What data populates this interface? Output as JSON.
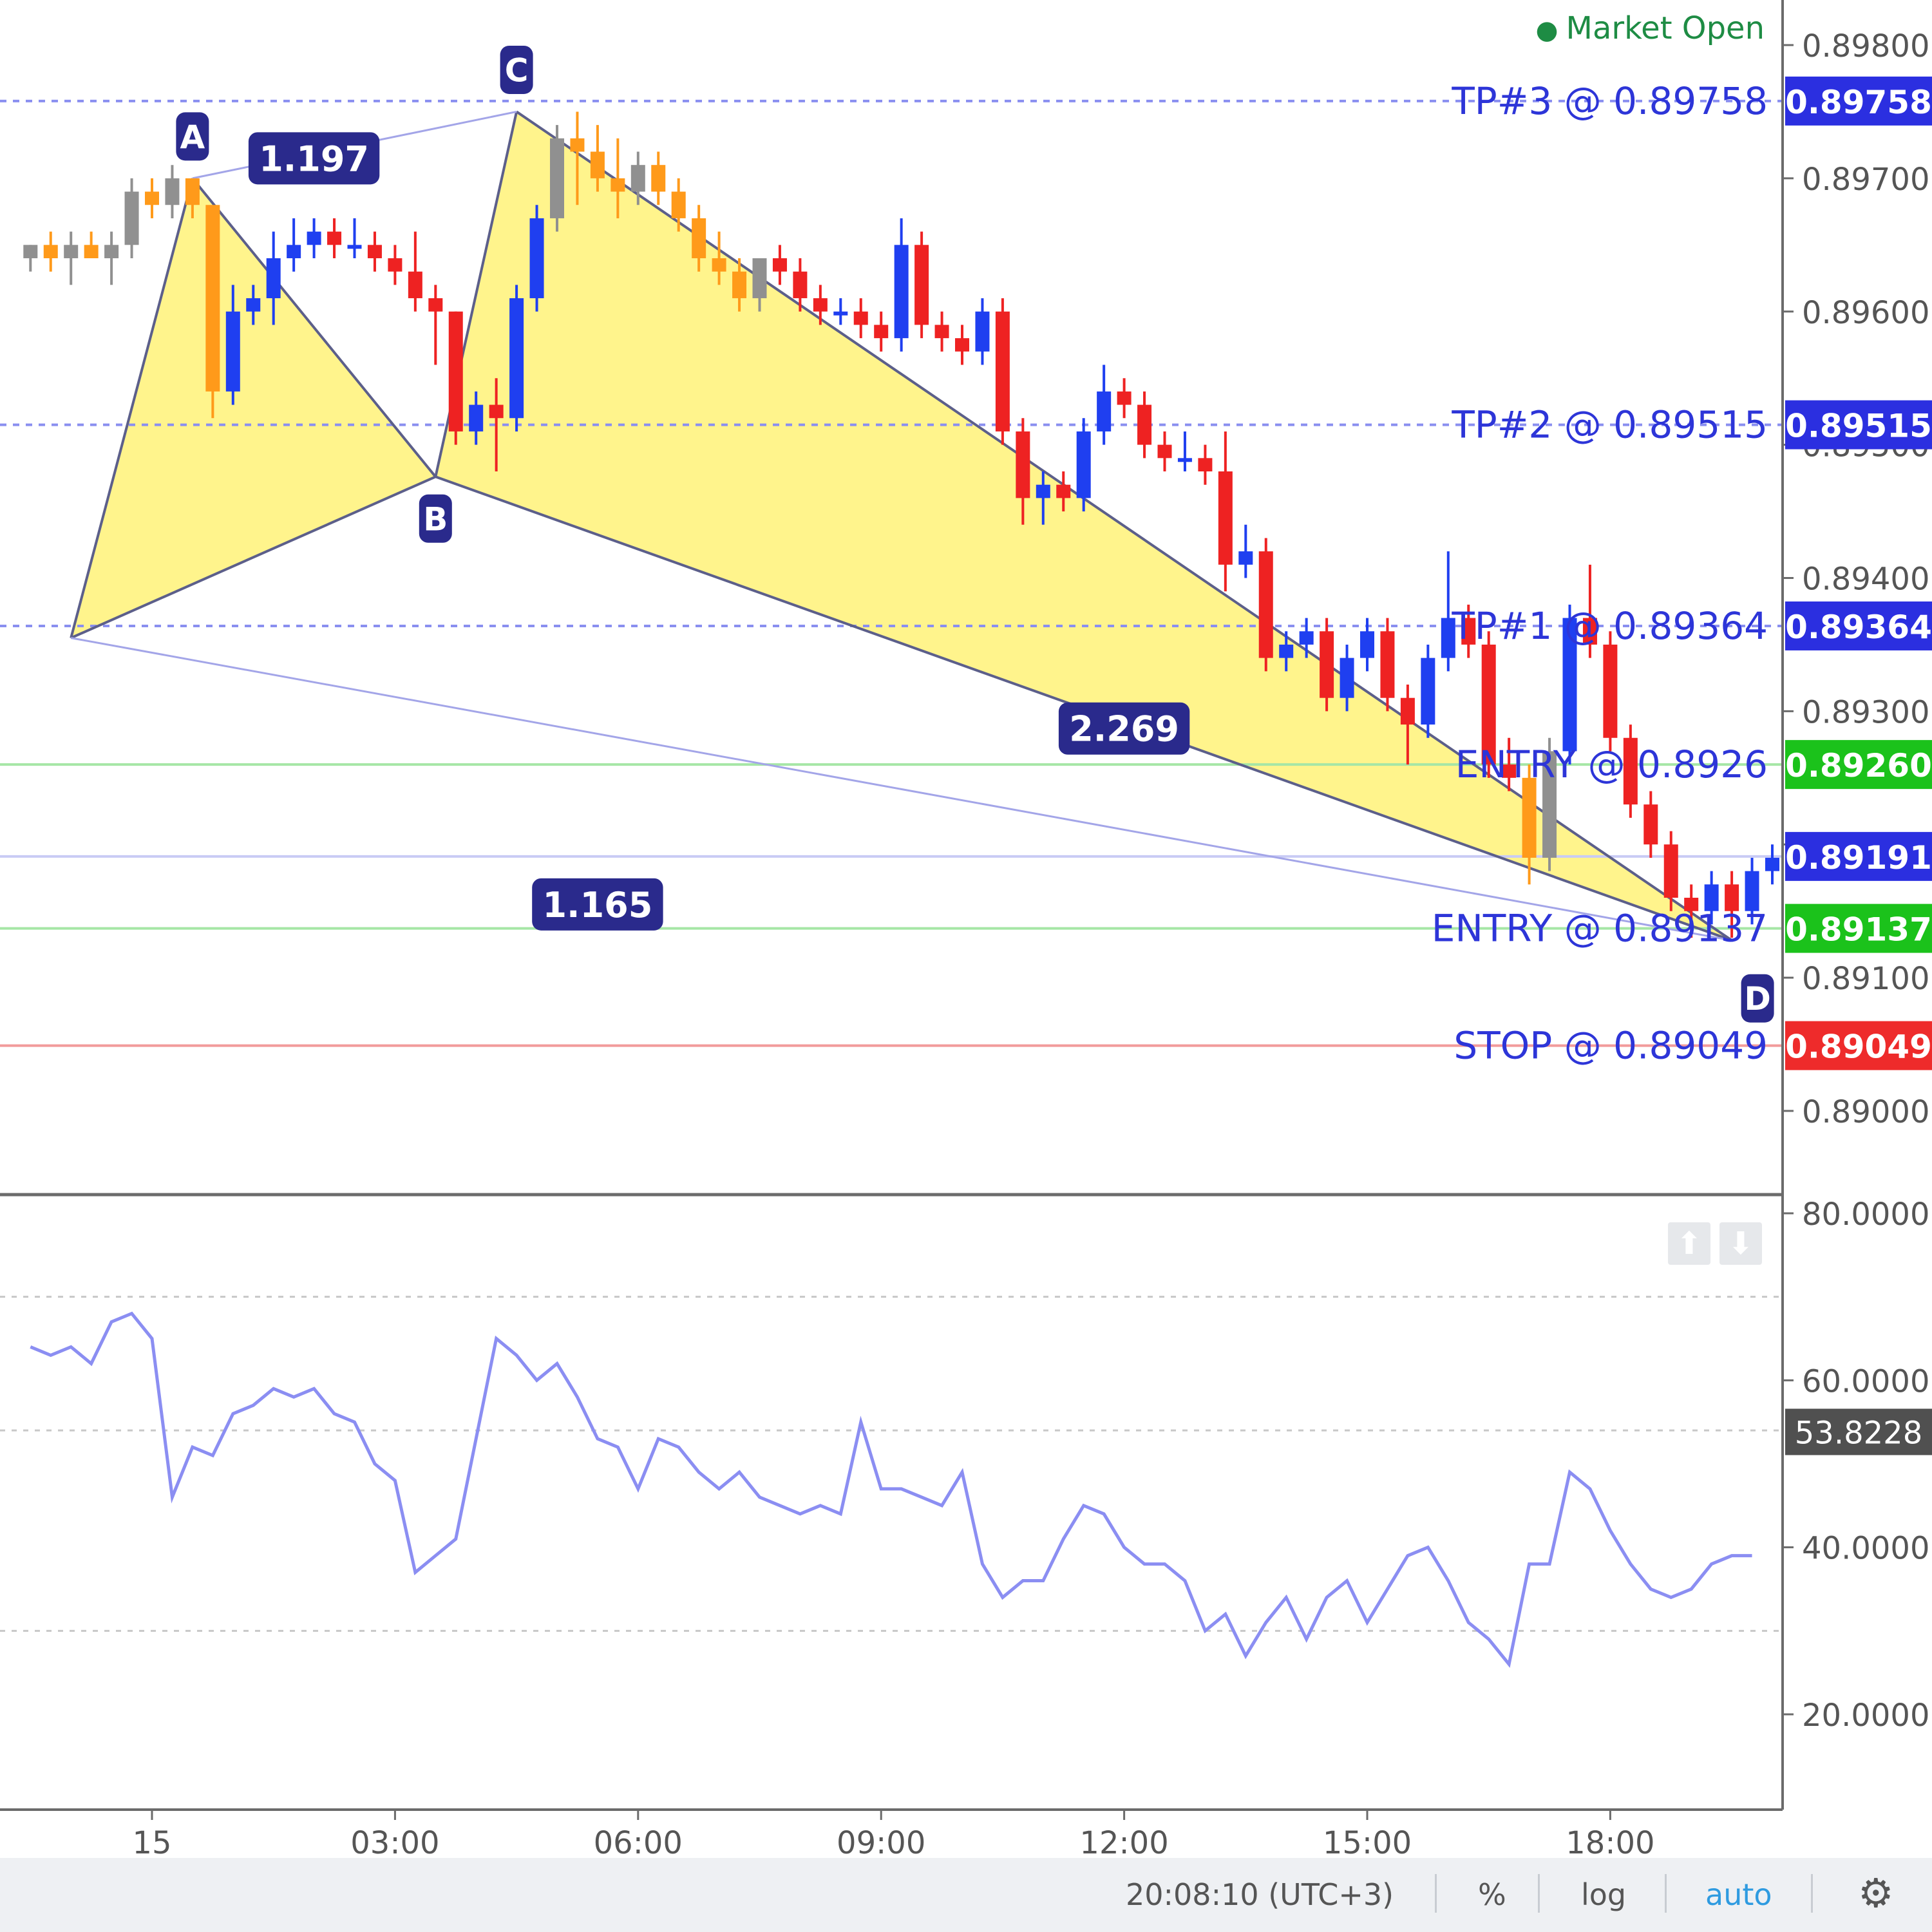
{
  "header": {
    "market_status": "Market Open"
  },
  "price_axis": {
    "ticks": [
      "0.89800",
      "0.89700",
      "0.89600",
      "0.89500",
      "0.89400",
      "0.89300",
      "0.89200",
      "0.89100",
      "0.89000"
    ],
    "tick_values": [
      0.898,
      0.897,
      0.896,
      0.895,
      0.894,
      0.893,
      0.892,
      0.891,
      0.89
    ]
  },
  "levels": [
    {
      "name": "tp3",
      "value": 0.89758,
      "label": "TP#3 @ 0.89758",
      "tag": "0.89758",
      "style": "dashed",
      "line_color": "#8a8ff0",
      "tag_color": "#2b2fe0"
    },
    {
      "name": "tp2",
      "value": 0.89515,
      "label": "TP#2 @ 0.89515",
      "tag": "0.89515",
      "style": "dashed",
      "line_color": "#8a8ff0",
      "tag_color": "#2b2fe0"
    },
    {
      "name": "tp1",
      "value": 0.89364,
      "label": "TP#1 @ 0.89364",
      "tag": "0.89364",
      "style": "dashed",
      "line_color": "#8a8ff0",
      "tag_color": "#2b2fe0"
    },
    {
      "name": "entry1",
      "value": 0.8926,
      "label": "ENTRY @ 0.8926",
      "tag": "0.89260",
      "style": "solid",
      "line_color": "#a6e6a6",
      "tag_color": "#1bc21b"
    },
    {
      "name": "last",
      "value": 0.89191,
      "label": "",
      "tag": "0.89191",
      "style": "solid",
      "line_color": "#c9cbf5",
      "tag_color": "#2b2fe0"
    },
    {
      "name": "entry2",
      "value": 0.89137,
      "label": "ENTRY @ 0.89137",
      "tag": "0.89137",
      "style": "solid",
      "line_color": "#a6e6a6",
      "tag_color": "#1bc21b"
    },
    {
      "name": "stop",
      "value": 0.89049,
      "label": "STOP @ 0.89049",
      "tag": "0.89049",
      "style": "solid",
      "line_color": "#f29b9b",
      "tag_color": "#ee2b2b"
    }
  ],
  "pattern": {
    "points": [
      {
        "label": "A",
        "x": "00:30",
        "value": 0.897
      },
      {
        "label": "B",
        "x": "03:30",
        "value": 0.89476
      },
      {
        "label": "C",
        "x": "04:30",
        "value": 0.8975
      },
      {
        "label": "D",
        "x": "19:30",
        "value": 0.89128
      }
    ],
    "X": {
      "x": "-01:00",
      "value": 0.89355
    },
    "ratios": [
      {
        "label": "1.197",
        "x": "02:00",
        "value": 0.89715
      },
      {
        "label": "2.269",
        "x": "12:00",
        "value": 0.89287
      },
      {
        "label": "1.165",
        "x": "05:30",
        "value": 0.89155
      }
    ],
    "fill_color": "#fff48c"
  },
  "x_axis": {
    "ticks": [
      "15",
      "03:00",
      "06:00",
      "09:00",
      "12:00",
      "15:00",
      "18:00"
    ],
    "tick_hours": [
      0,
      3,
      6,
      9,
      12,
      15,
      18
    ]
  },
  "oscillator": {
    "ticks": [
      "80.0000",
      "60.0000",
      "40.0000",
      "20.0000"
    ],
    "tick_values": [
      80,
      60,
      40,
      20
    ],
    "bands": [
      70,
      54,
      30
    ],
    "current": "53.8228",
    "current_value": 53.82
  },
  "status_bar": {
    "clock": "20:08:10 (UTC+3)",
    "percent": "%",
    "log": "log",
    "auto": "auto"
  },
  "chart_data": {
    "type": "candlestick",
    "x_unit": "hours since 00:00",
    "colors": {
      "up": "#1f3ff0",
      "down": "#ee2222",
      "pattern_up": "#909090",
      "pattern_down": "#ff9a1a",
      "line": "#8b8ef2"
    },
    "candles": [
      [
        -1.5,
        0.8964,
        0.8965,
        0.8963,
        0.8965
      ],
      [
        -1.25,
        0.8965,
        0.8966,
        0.8963,
        0.8964
      ],
      [
        -1.0,
        0.8964,
        0.8966,
        0.8962,
        0.8965
      ],
      [
        -0.75,
        0.8965,
        0.8966,
        0.8964,
        0.8964
      ],
      [
        -0.5,
        0.8964,
        0.8966,
        0.8962,
        0.8965
      ],
      [
        -0.25,
        0.8965,
        0.897,
        0.8964,
        0.8969
      ],
      [
        0.0,
        0.8969,
        0.897,
        0.8967,
        0.8968
      ],
      [
        0.25,
        0.8968,
        0.8971,
        0.8967,
        0.897
      ],
      [
        0.5,
        0.897,
        0.8969,
        0.8967,
        0.8968
      ],
      [
        0.75,
        0.8968,
        0.8963,
        0.8952,
        0.8954
      ],
      [
        1.0,
        0.8954,
        0.8962,
        0.8953,
        0.896
      ],
      [
        1.25,
        0.896,
        0.8962,
        0.8959,
        0.8961
      ],
      [
        1.5,
        0.8961,
        0.8966,
        0.8959,
        0.8964
      ],
      [
        1.75,
        0.8964,
        0.8967,
        0.8963,
        0.8965
      ],
      [
        2.0,
        0.8965,
        0.8967,
        0.8964,
        0.8966
      ],
      [
        2.25,
        0.8966,
        0.8967,
        0.8964,
        0.8965
      ],
      [
        2.5,
        0.8965,
        0.8967,
        0.8964,
        0.8965
      ],
      [
        2.75,
        0.8965,
        0.8966,
        0.8963,
        0.8964
      ],
      [
        3.0,
        0.8964,
        0.8965,
        0.8962,
        0.8963
      ],
      [
        3.25,
        0.8963,
        0.8966,
        0.896,
        0.8961
      ],
      [
        3.5,
        0.8961,
        0.8962,
        0.8956,
        0.896
      ],
      [
        3.75,
        0.896,
        0.896,
        0.895,
        0.8951
      ],
      [
        4.0,
        0.8951,
        0.8954,
        0.895,
        0.8953
      ],
      [
        4.25,
        0.8953,
        0.8955,
        0.8948,
        0.8952
      ],
      [
        4.5,
        0.8952,
        0.8962,
        0.8951,
        0.8961
      ],
      [
        4.75,
        0.8961,
        0.8968,
        0.896,
        0.8967
      ],
      [
        5.0,
        0.8967,
        0.8974,
        0.8966,
        0.8973
      ],
      [
        5.25,
        0.8973,
        0.8975,
        0.8968,
        0.8972
      ],
      [
        5.5,
        0.8972,
        0.8974,
        0.8969,
        0.897
      ],
      [
        5.75,
        0.897,
        0.8973,
        0.8967,
        0.8969
      ],
      [
        6.0,
        0.8969,
        0.8972,
        0.8968,
        0.8971
      ],
      [
        6.25,
        0.8971,
        0.8972,
        0.8968,
        0.8969
      ],
      [
        6.5,
        0.8969,
        0.897,
        0.8966,
        0.8967
      ],
      [
        6.75,
        0.8967,
        0.8968,
        0.8963,
        0.8964
      ],
      [
        7.0,
        0.8964,
        0.8966,
        0.8962,
        0.8963
      ],
      [
        7.25,
        0.8963,
        0.8964,
        0.896,
        0.8961
      ],
      [
        7.5,
        0.8961,
        0.8964,
        0.896,
        0.8964
      ],
      [
        7.75,
        0.8964,
        0.8965,
        0.8962,
        0.8963
      ],
      [
        8.0,
        0.8963,
        0.8964,
        0.896,
        0.8961
      ],
      [
        8.25,
        0.8961,
        0.8962,
        0.8959,
        0.896
      ],
      [
        8.5,
        0.896,
        0.8961,
        0.8959,
        0.896
      ],
      [
        8.75,
        0.896,
        0.8961,
        0.8958,
        0.8959
      ],
      [
        9.0,
        0.8959,
        0.896,
        0.8957,
        0.8958
      ],
      [
        9.25,
        0.8958,
        0.8967,
        0.8957,
        0.8965
      ],
      [
        9.5,
        0.8965,
        0.8966,
        0.8958,
        0.8959
      ],
      [
        9.75,
        0.8959,
        0.896,
        0.8957,
        0.8958
      ],
      [
        10.0,
        0.8958,
        0.8959,
        0.8956,
        0.8957
      ],
      [
        10.25,
        0.8957,
        0.8961,
        0.8956,
        0.896
      ],
      [
        10.5,
        0.896,
        0.8961,
        0.895,
        0.8951
      ],
      [
        10.75,
        0.8951,
        0.8952,
        0.8944,
        0.8946
      ],
      [
        11.0,
        0.8946,
        0.8948,
        0.8944,
        0.8947
      ],
      [
        11.25,
        0.8947,
        0.8948,
        0.8945,
        0.8946
      ],
      [
        11.5,
        0.8946,
        0.8952,
        0.8945,
        0.8951
      ],
      [
        11.75,
        0.8951,
        0.8956,
        0.895,
        0.8954
      ],
      [
        12.0,
        0.8954,
        0.8955,
        0.8952,
        0.8953
      ],
      [
        12.25,
        0.8953,
        0.8954,
        0.8949,
        0.895
      ],
      [
        12.5,
        0.895,
        0.8951,
        0.8948,
        0.8949
      ],
      [
        12.75,
        0.8949,
        0.8951,
        0.8948,
        0.8949
      ],
      [
        13.0,
        0.8949,
        0.895,
        0.8947,
        0.8948
      ],
      [
        13.25,
        0.8948,
        0.8951,
        0.8939,
        0.8941
      ],
      [
        13.5,
        0.8941,
        0.8944,
        0.894,
        0.8942
      ],
      [
        13.75,
        0.8942,
        0.8943,
        0.8933,
        0.8934
      ],
      [
        14.0,
        0.8934,
        0.8936,
        0.8933,
        0.8935
      ],
      [
        14.25,
        0.8935,
        0.8937,
        0.8934,
        0.8936
      ],
      [
        14.5,
        0.8936,
        0.8937,
        0.893,
        0.8931
      ],
      [
        14.75,
        0.8931,
        0.8935,
        0.893,
        0.8934
      ],
      [
        15.0,
        0.8934,
        0.8937,
        0.8933,
        0.8936
      ],
      [
        15.25,
        0.8936,
        0.8937,
        0.893,
        0.8931
      ],
      [
        15.5,
        0.8931,
        0.8932,
        0.8926,
        0.8929
      ],
      [
        15.75,
        0.8929,
        0.8935,
        0.8928,
        0.8934
      ],
      [
        16.0,
        0.8934,
        0.8942,
        0.8933,
        0.8937
      ],
      [
        16.25,
        0.8937,
        0.8938,
        0.8934,
        0.8935
      ],
      [
        16.5,
        0.8935,
        0.8936,
        0.8925,
        0.8926
      ],
      [
        16.75,
        0.8926,
        0.8928,
        0.8924,
        0.8925
      ],
      [
        17.0,
        0.8925,
        0.8926,
        0.8917,
        0.8919
      ],
      [
        17.25,
        0.8919,
        0.8928,
        0.8918,
        0.8927
      ],
      [
        17.5,
        0.8927,
        0.8938,
        0.8926,
        0.8937
      ],
      [
        17.75,
        0.8937,
        0.8941,
        0.8934,
        0.8935
      ],
      [
        18.0,
        0.8935,
        0.8936,
        0.8927,
        0.8928
      ],
      [
        18.25,
        0.8928,
        0.8929,
        0.8922,
        0.8923
      ],
      [
        18.5,
        0.8923,
        0.8924,
        0.8919,
        0.892
      ],
      [
        18.75,
        0.892,
        0.8921,
        0.8915,
        0.8916
      ],
      [
        19.0,
        0.8916,
        0.8917,
        0.8913,
        0.8915
      ],
      [
        19.25,
        0.8915,
        0.8918,
        0.8914,
        0.8917
      ],
      [
        19.5,
        0.8917,
        0.8918,
        0.8913,
        0.8915
      ],
      [
        19.75,
        0.8915,
        0.8919,
        0.8914,
        0.8918
      ],
      [
        20.0,
        0.8918,
        0.892,
        0.8917,
        0.8919
      ]
    ],
    "pattern_candle_range": [
      -1.5,
      0.75
    ],
    "pattern_candle_range2": [
      5.0,
      7.5
    ],
    "pattern_candle_range3": [
      17.0,
      17.25
    ],
    "oscillator_values": [
      [
        -1.5,
        64
      ],
      [
        -1.25,
        63
      ],
      [
        -1.0,
        64
      ],
      [
        -0.75,
        62
      ],
      [
        -0.5,
        67
      ],
      [
        -0.25,
        68
      ],
      [
        0.0,
        65
      ],
      [
        0.25,
        46
      ],
      [
        0.5,
        52
      ],
      [
        0.75,
        51
      ],
      [
        1.0,
        56
      ],
      [
        1.25,
        57
      ],
      [
        1.5,
        59
      ],
      [
        1.75,
        58
      ],
      [
        2.0,
        59
      ],
      [
        2.25,
        56
      ],
      [
        2.5,
        55
      ],
      [
        2.75,
        50
      ],
      [
        3.0,
        48
      ],
      [
        3.25,
        37
      ],
      [
        3.5,
        39
      ],
      [
        3.75,
        41
      ],
      [
        4.0,
        53
      ],
      [
        4.25,
        65
      ],
      [
        4.5,
        63
      ],
      [
        4.75,
        60
      ],
      [
        5.0,
        62
      ],
      [
        5.25,
        58
      ],
      [
        5.5,
        53
      ],
      [
        5.75,
        52
      ],
      [
        6.0,
        47
      ],
      [
        6.25,
        53
      ],
      [
        6.5,
        52
      ],
      [
        6.75,
        49
      ],
      [
        7.0,
        47
      ],
      [
        7.25,
        49
      ],
      [
        7.5,
        46
      ],
      [
        7.75,
        45
      ],
      [
        8.0,
        44
      ],
      [
        8.25,
        45
      ],
      [
        8.5,
        44
      ],
      [
        8.75,
        55
      ],
      [
        9.0,
        47
      ],
      [
        9.25,
        47
      ],
      [
        9.5,
        46
      ],
      [
        9.75,
        45
      ],
      [
        10.0,
        49
      ],
      [
        10.25,
        38
      ],
      [
        10.5,
        34
      ],
      [
        10.75,
        36
      ],
      [
        11.0,
        36
      ],
      [
        11.25,
        41
      ],
      [
        11.5,
        45
      ],
      [
        11.75,
        44
      ],
      [
        12.0,
        40
      ],
      [
        12.25,
        38
      ],
      [
        12.5,
        38
      ],
      [
        12.75,
        36
      ],
      [
        13.0,
        30
      ],
      [
        13.25,
        32
      ],
      [
        13.5,
        27
      ],
      [
        13.75,
        31
      ],
      [
        14.0,
        34
      ],
      [
        14.25,
        29
      ],
      [
        14.5,
        34
      ],
      [
        14.75,
        36
      ],
      [
        15.0,
        31
      ],
      [
        15.25,
        35
      ],
      [
        15.5,
        39
      ],
      [
        15.75,
        40
      ],
      [
        16.0,
        36
      ],
      [
        16.25,
        31
      ],
      [
        16.5,
        29
      ],
      [
        16.75,
        26
      ],
      [
        17.0,
        38
      ],
      [
        17.25,
        38
      ],
      [
        17.5,
        49
      ],
      [
        17.75,
        47
      ],
      [
        18.0,
        42
      ],
      [
        18.25,
        38
      ],
      [
        18.5,
        35
      ],
      [
        18.75,
        34
      ],
      [
        19.0,
        35
      ],
      [
        19.25,
        38
      ],
      [
        19.5,
        39
      ],
      [
        19.75,
        39
      ]
    ]
  }
}
